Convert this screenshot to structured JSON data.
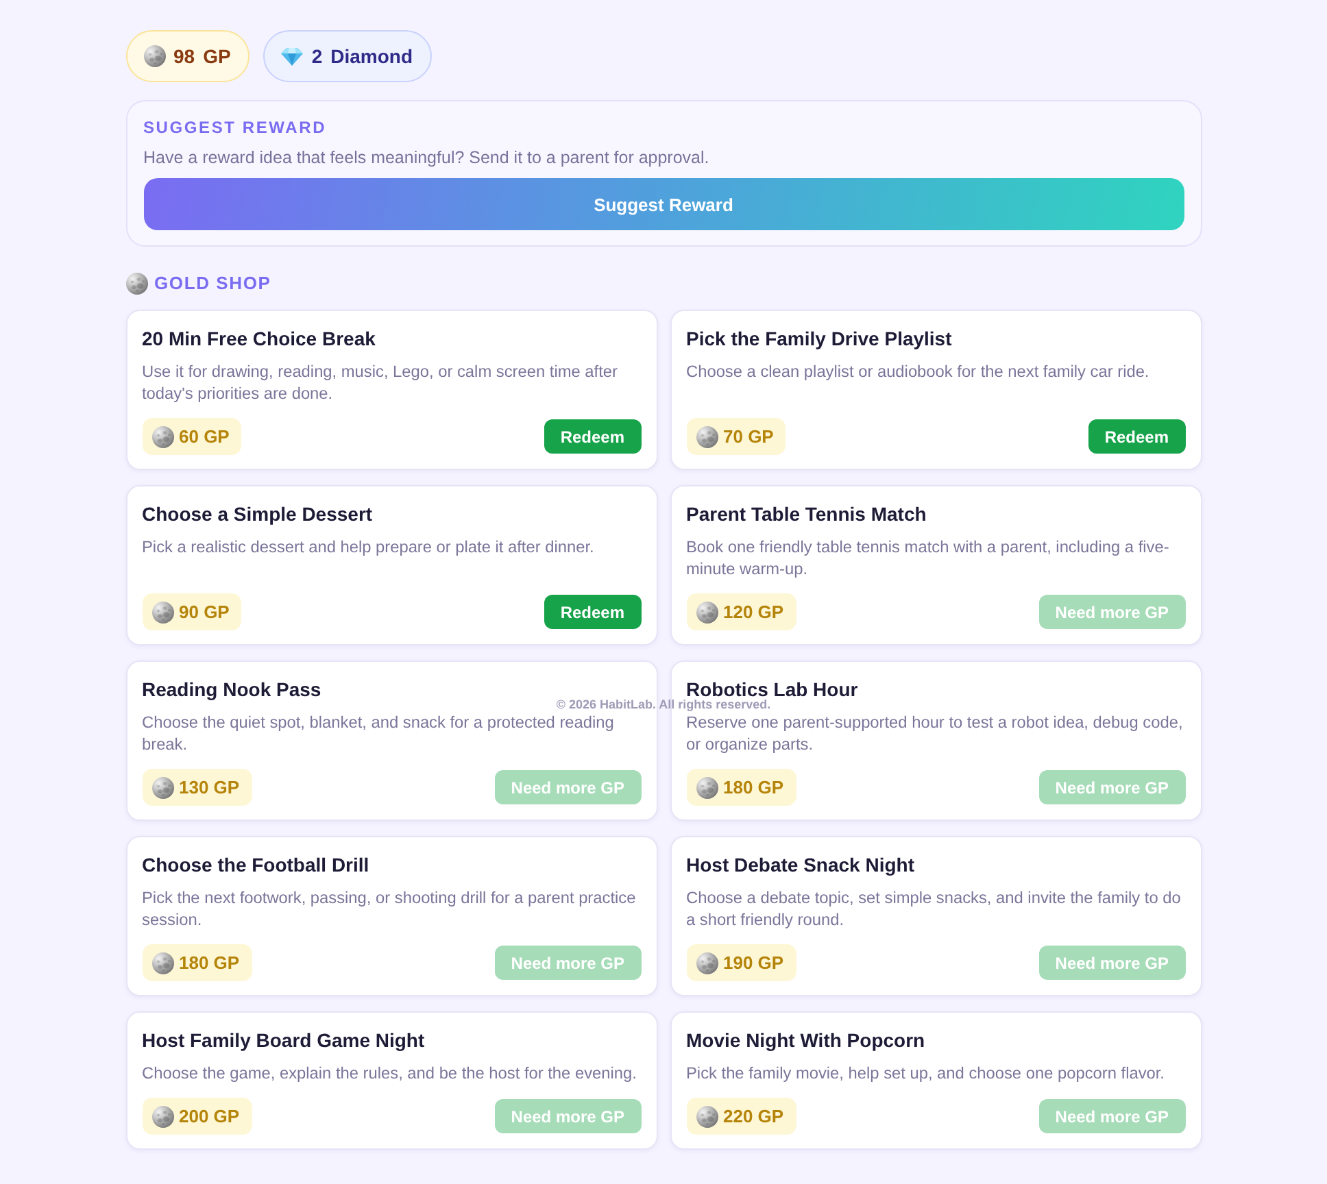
{
  "balances": [
    {
      "kind": "gold",
      "amount": "98",
      "unit": "GP"
    },
    {
      "kind": "diamond",
      "amount": "2",
      "unit": "Diamond"
    }
  ],
  "suggest": {
    "title": "SUGGEST REWARD",
    "description": "Have a reward idea that feels meaningful? Send it to a parent for approval.",
    "button": "Suggest Reward"
  },
  "shop": {
    "title": "GOLD SHOP",
    "items": [
      {
        "title": "20 Min Free Choice Break",
        "description": "Use it for drawing, reading, music, Lego, or calm screen time after today's priorities are done.",
        "price": "60 GP",
        "action": "Redeem",
        "disabled": false
      },
      {
        "title": "Pick the Family Drive Playlist",
        "description": "Choose a clean playlist or audiobook for the next family car ride.",
        "price": "70 GP",
        "action": "Redeem",
        "disabled": false
      },
      {
        "title": "Choose a Simple Dessert",
        "description": "Pick a realistic dessert and help prepare or plate it after dinner.",
        "price": "90 GP",
        "action": "Redeem",
        "disabled": false
      },
      {
        "title": "Parent Table Tennis Match",
        "description": "Book one friendly table tennis match with a parent, including a five-minute warm-up.",
        "price": "120 GP",
        "action": "Need more GP",
        "disabled": true
      },
      {
        "title": "Reading Nook Pass",
        "description": "Choose the quiet spot, blanket, and snack for a protected reading break.",
        "price": "130 GP",
        "action": "Need more GP",
        "disabled": true
      },
      {
        "title": "Robotics Lab Hour",
        "description": "Reserve one parent-supported hour to test a robot idea, debug code, or organize parts.",
        "price": "180 GP",
        "action": "Need more GP",
        "disabled": true
      },
      {
        "title": "Choose the Football Drill",
        "description": "Pick the next footwork, passing, or shooting drill for a parent practice session.",
        "price": "180 GP",
        "action": "Need more GP",
        "disabled": true
      },
      {
        "title": "Host Debate Snack Night",
        "description": "Choose a debate topic, set simple snacks, and invite the family to do a short friendly round.",
        "price": "190 GP",
        "action": "Need more GP",
        "disabled": true
      },
      {
        "title": "Host Family Board Game Night",
        "description": "Choose the game, explain the rules, and be the host for the evening.",
        "price": "200 GP",
        "action": "Need more GP",
        "disabled": true
      },
      {
        "title": "Movie Night With Popcorn",
        "description": "Pick the family movie, help set up, and choose one popcorn flavor.",
        "price": "220 GP",
        "action": "Need more GP",
        "disabled": true
      }
    ]
  },
  "footer": "© 2026 HabitLab. All rights reserved."
}
